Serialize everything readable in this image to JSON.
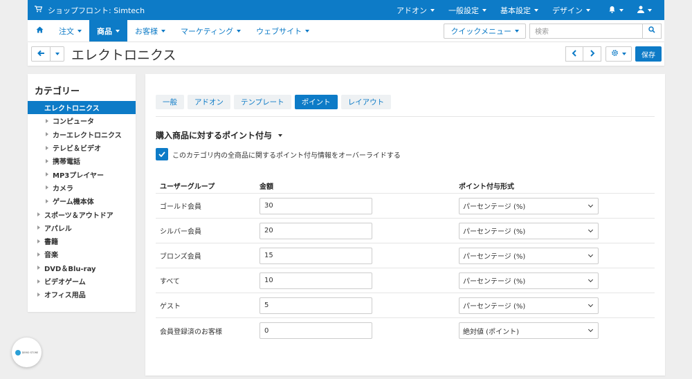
{
  "topbar": {
    "store_label": "ショップフロント: Simtech",
    "menus": [
      "アドオン",
      "一般設定",
      "基本設定",
      "デザイン"
    ]
  },
  "navbar": {
    "items": [
      "注文",
      "商品",
      "お客様",
      "マーケティング",
      "ウェブサイト"
    ],
    "active_index": 1,
    "quick_menu": "クイックメニュー",
    "search_placeholder": "検索"
  },
  "titlebar": {
    "title": "エレクトロニクス",
    "save_label": "保存"
  },
  "sidebar": {
    "heading": "カテゴリー",
    "categories": [
      {
        "label": "エレクトロニクス",
        "level": 0,
        "active": true
      },
      {
        "label": "コンピュータ",
        "level": 1
      },
      {
        "label": "カーエレクトロニクス",
        "level": 1
      },
      {
        "label": "テレビ＆ビデオ",
        "level": 1
      },
      {
        "label": "携帯電話",
        "level": 1
      },
      {
        "label": "MP3プレイヤー",
        "level": 1
      },
      {
        "label": "カメラ",
        "level": 1
      },
      {
        "label": "ゲーム機本体",
        "level": 1
      },
      {
        "label": "スポーツ＆アウトドア",
        "level": 0
      },
      {
        "label": "アパレル",
        "level": 0
      },
      {
        "label": "書籍",
        "level": 0
      },
      {
        "label": "音楽",
        "level": 0
      },
      {
        "label": "DVD＆Blu-ray",
        "level": 0
      },
      {
        "label": "ビデオゲーム",
        "level": 0
      },
      {
        "label": "オフィス用品",
        "level": 0
      }
    ]
  },
  "main": {
    "tabs": [
      "一般",
      "アドオン",
      "テンプレート",
      "ポイント",
      "レイアウト"
    ],
    "active_tab": 3,
    "section_title": "購入商品に対するポイント付与",
    "override_label": "このカテゴリ内の全商品に関するポイント付与情報をオーバーライドする",
    "override_checked": true,
    "columns": [
      "ユーザーグループ",
      "金額",
      "ポイント付与形式"
    ],
    "rows": [
      {
        "group": "ゴールド会員",
        "amount": "30",
        "type": "パーセンテージ (%)"
      },
      {
        "group": "シルバー会員",
        "amount": "20",
        "type": "パーセンテージ (%)"
      },
      {
        "group": "ブロンズ会員",
        "amount": "15",
        "type": "パーセンテージ (%)"
      },
      {
        "group": "すべて",
        "amount": "10",
        "type": "パーセンテージ (%)"
      },
      {
        "group": "ゲスト",
        "amount": "5",
        "type": "パーセンテージ (%)"
      },
      {
        "group": "会員登録済のお客様",
        "amount": "0",
        "type": "絶対値 (ポイント)"
      }
    ]
  },
  "demo_badge": {
    "label": "DEMO STORE"
  },
  "colors": {
    "accent": "#0d7bc7",
    "background": "#eeeeee"
  }
}
